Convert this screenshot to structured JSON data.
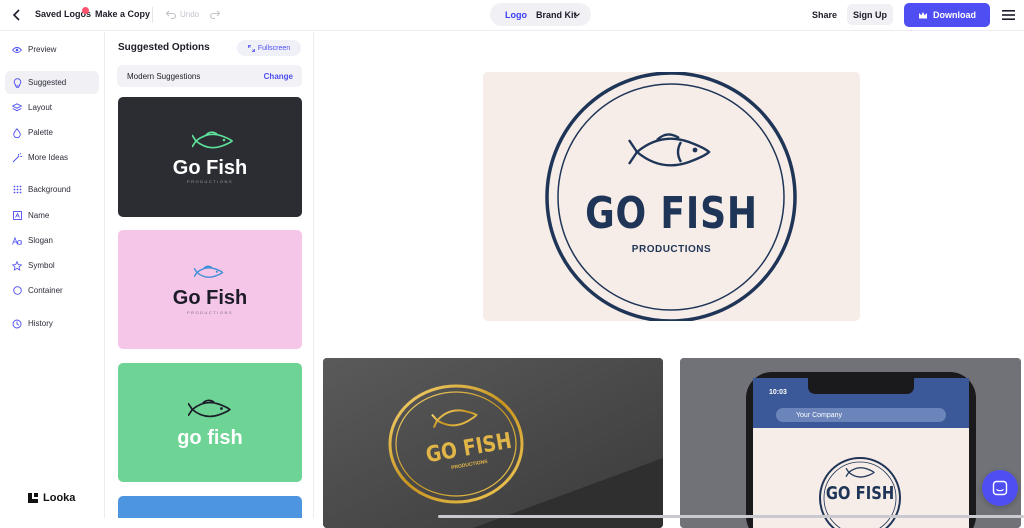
{
  "topbar": {
    "back_icon": "chevron-left-icon",
    "saved_logos": "Saved Logos",
    "make_copy": "Make a Copy",
    "undo": "Undo",
    "tab_logo": "Logo",
    "tab_brand_kit": "Brand Kit",
    "share": "Share",
    "sign_up": "Sign Up",
    "download": "Download",
    "colors": {
      "accent": "#4e4ef2",
      "badge": "#ff5470"
    }
  },
  "sidebar": {
    "items": [
      {
        "label": "Preview",
        "icon": "eye-icon"
      },
      {
        "label": "Suggested",
        "icon": "bulb-icon",
        "active": true
      },
      {
        "label": "Layout",
        "icon": "layers-icon"
      },
      {
        "label": "Palette",
        "icon": "drop-icon"
      },
      {
        "label": "More Ideas",
        "icon": "wand-icon"
      },
      {
        "label": "Background",
        "icon": "grid-icon"
      },
      {
        "label": "Name",
        "icon": "name-icon"
      },
      {
        "label": "Slogan",
        "icon": "font-icon"
      },
      {
        "label": "Symbol",
        "icon": "star-icon"
      },
      {
        "label": "Container",
        "icon": "circle-icon"
      },
      {
        "label": "History",
        "icon": "history-icon"
      }
    ],
    "brand": "Looka"
  },
  "suggestions": {
    "title": "Suggested Options",
    "fullscreen": "Fullscreen",
    "mode_label": "Modern Suggestions",
    "change": "Change",
    "cards": [
      {
        "word": "Go Fish",
        "sub": "PRODUCTIONS",
        "bg": "#2b2d33",
        "fg": "#ffffff",
        "icon_color": "#5ee29a"
      },
      {
        "word": "Go Fish",
        "sub": "PRODUCTIONS",
        "bg": "#f6c6e9",
        "fg": "#1c1c28",
        "icon_color": "#3d8fd6"
      },
      {
        "word": "go fish",
        "sub": "",
        "bg": "#6ed495",
        "fg": "#ffffff",
        "icon_color": "#1c1c28"
      }
    ]
  },
  "preview": {
    "name": "GO FISH",
    "tagline": "PRODUCTIONS",
    "color": "#1f3557",
    "bg": "#f6ede8"
  },
  "mockups": {
    "stamp_name": "GO FISH",
    "stamp_tagline": "PRODUCTIONS",
    "phone_time": "10:03",
    "phone_search": "Your Company",
    "phone_name": "GO FISH"
  },
  "chat_icon": "chat-icon"
}
